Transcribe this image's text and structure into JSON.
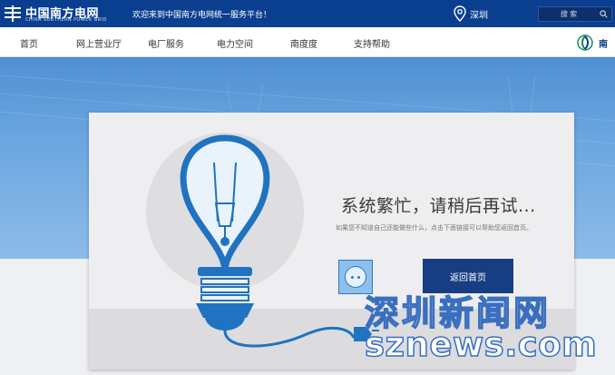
{
  "topbar": {
    "logo_cn": "中国南方电网",
    "logo_en": "CHINA SOUTHERN POWER GRID",
    "welcome": "欢迎来到中国南方电网统一服务平台！",
    "city": "深圳",
    "search_placeholder": "搜 索"
  },
  "nav": {
    "items": [
      {
        "label": "首页"
      },
      {
        "label": "网上营业厅"
      },
      {
        "label": "电厂服务"
      },
      {
        "label": "电力空间"
      },
      {
        "label": "南度度"
      },
      {
        "label": "支持帮助"
      }
    ],
    "brand_label": "南"
  },
  "error": {
    "title": "系统繁忙，请稍后再试...",
    "description": "如果您不知道自己还能做些什么，点击下面链接可以帮助您返回首页。",
    "home_button": "返回首页"
  },
  "watermark": {
    "cn": "深圳新闻网",
    "en": "sznews.com"
  },
  "colors": {
    "topbar": "#0a3e8f",
    "accent_blue": "#2f78c6",
    "button": "#173e82"
  }
}
